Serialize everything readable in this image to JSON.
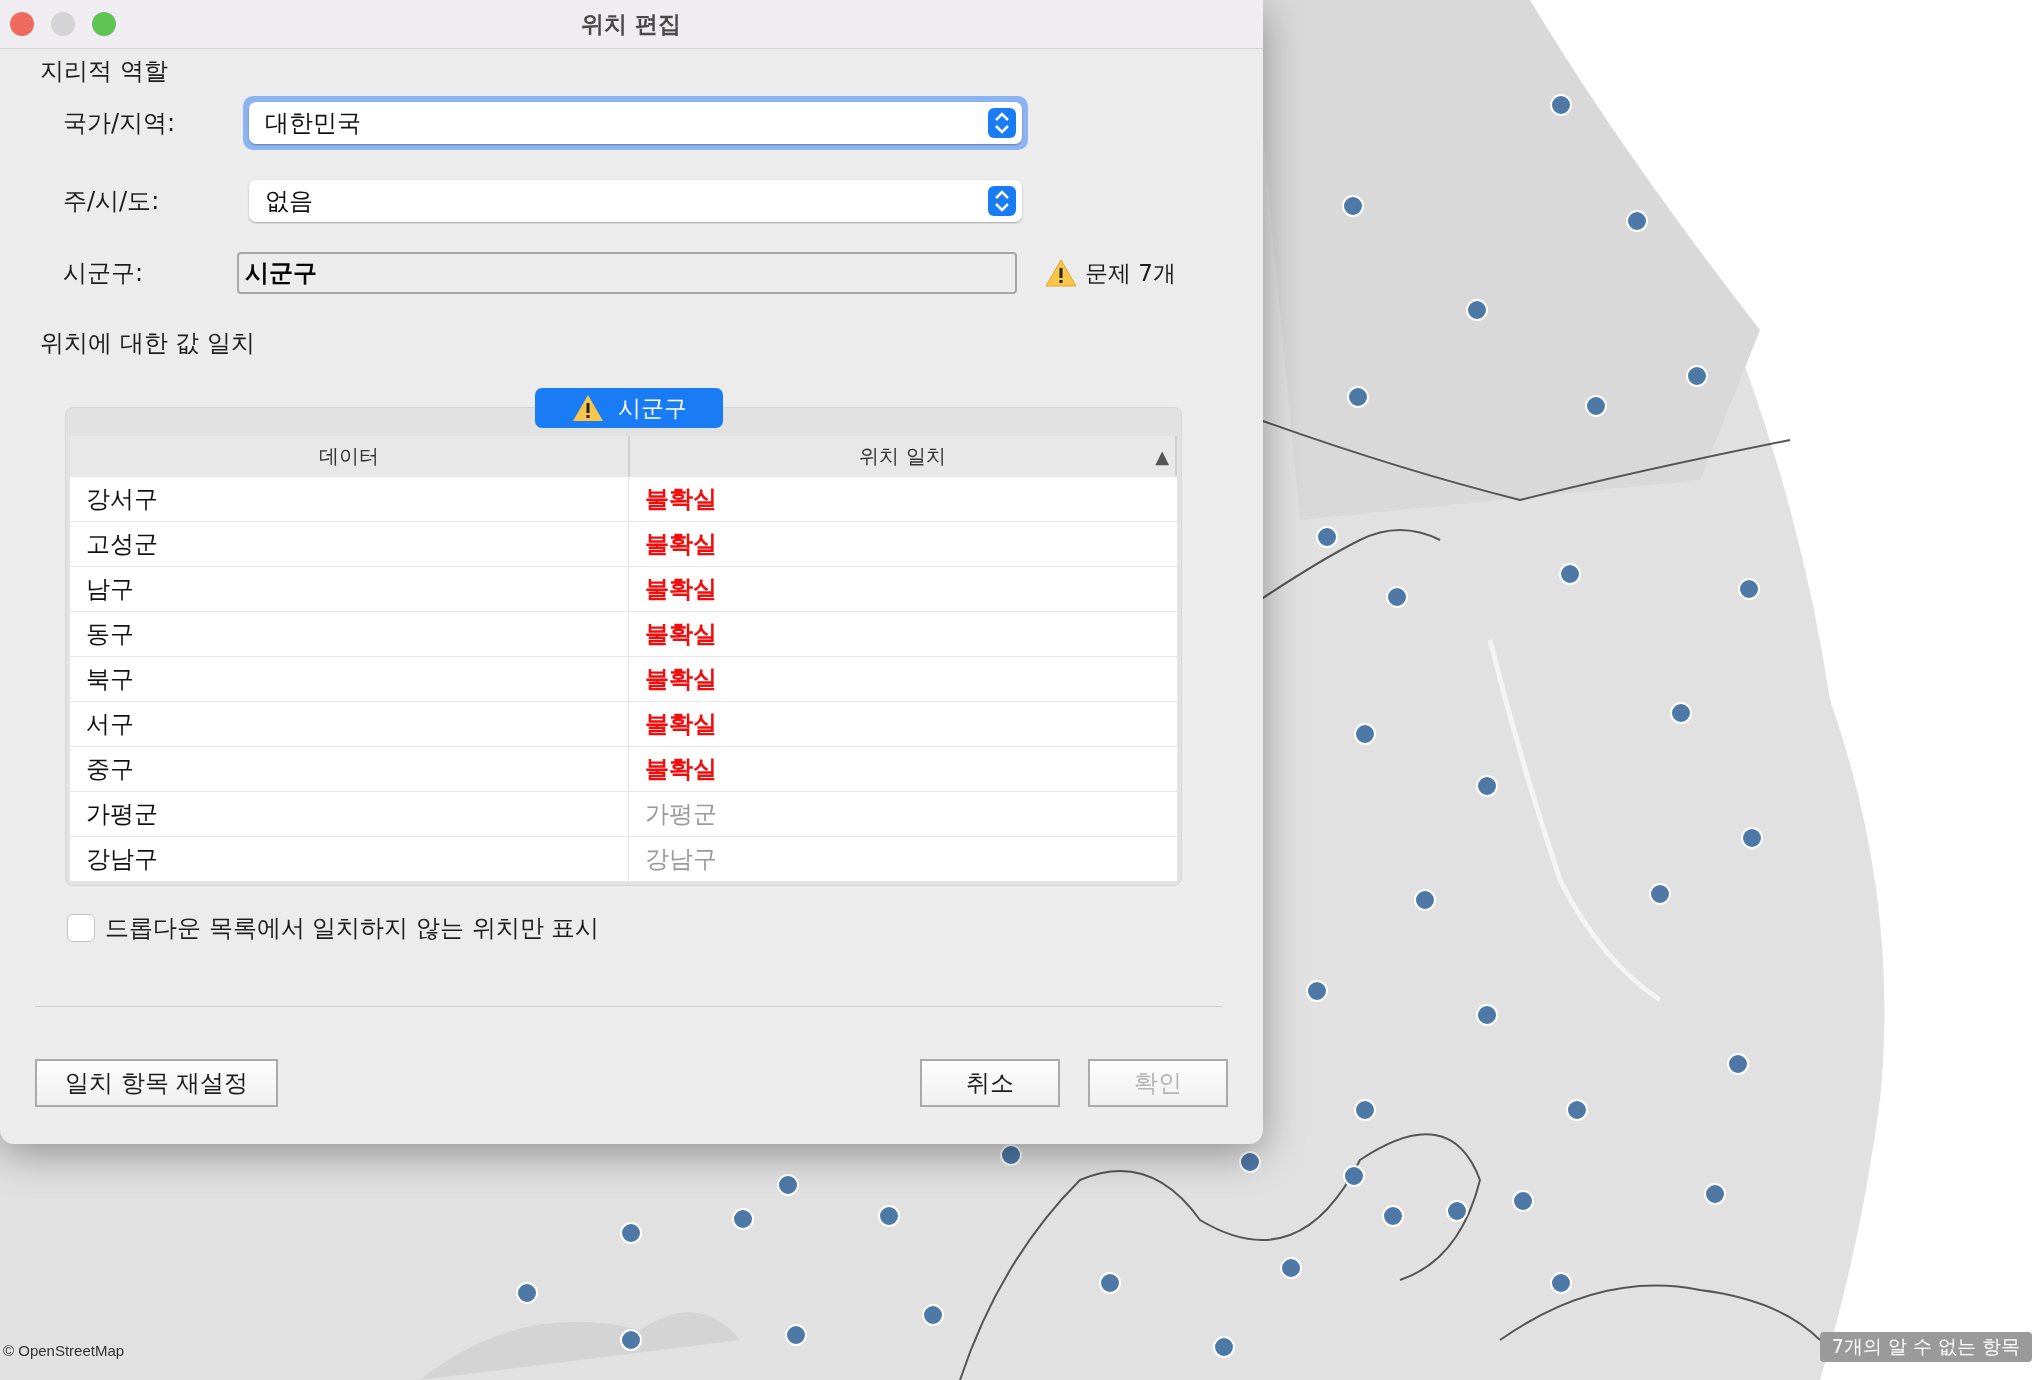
{
  "window": {
    "title": "위치 편집"
  },
  "geographic_role": {
    "heading": "지리적 역할",
    "fields": [
      {
        "kind": "dropdown",
        "label": "국가/지역:",
        "value": "대한민국",
        "focused": true
      },
      {
        "kind": "dropdown",
        "label": "주/시/도:",
        "value": "없음",
        "focused": false
      },
      {
        "kind": "text",
        "label": "시군구:",
        "value": "시군구",
        "warning": "문제 7개"
      }
    ]
  },
  "matching": {
    "heading": "위치에 대한 값 일치",
    "tab": "시군구",
    "columns": [
      {
        "label": "데이터"
      },
      {
        "label": "위치 일치",
        "sort": "▲"
      }
    ],
    "rows": [
      {
        "data": "강서구",
        "match": "불확실",
        "uncertain": true
      },
      {
        "data": "고성군",
        "match": "불확실",
        "uncertain": true
      },
      {
        "data": "남구",
        "match": "불확실",
        "uncertain": true
      },
      {
        "data": "동구",
        "match": "불확실",
        "uncertain": true
      },
      {
        "data": "북구",
        "match": "불확실",
        "uncertain": true
      },
      {
        "data": "서구",
        "match": "불확실",
        "uncertain": true
      },
      {
        "data": "중구",
        "match": "불확실",
        "uncertain": true
      },
      {
        "data": "가평군",
        "match": "가평군",
        "uncertain": false
      },
      {
        "data": "강남구",
        "match": "강남구",
        "uncertain": false
      }
    ],
    "filter": {
      "label": "드롭다운 목록에서 일치하지 않는 위치만 표시",
      "checked": false
    }
  },
  "buttons": [
    {
      "label": "일치 항목 재설정",
      "disabled": false
    },
    {
      "label": "취소",
      "disabled": false
    },
    {
      "label": "확인",
      "disabled": true
    }
  ],
  "map": {
    "attribution": "© OpenStreetMap",
    "unknown_badge": "7개의 알 수 없는 항목"
  }
}
